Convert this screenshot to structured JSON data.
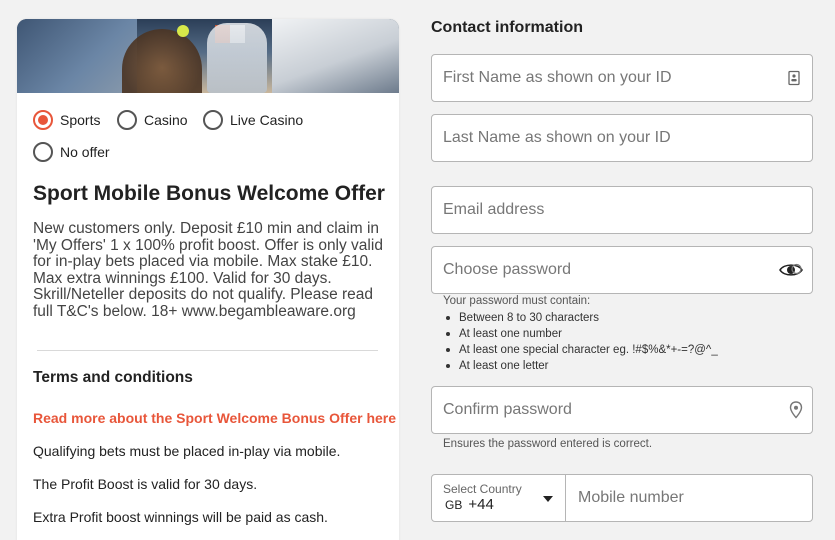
{
  "offer_card": {
    "options": [
      {
        "label": "Sports",
        "selected": true
      },
      {
        "label": "Casino",
        "selected": false
      },
      {
        "label": "Live Casino",
        "selected": false
      },
      {
        "label": "No offer",
        "selected": false
      }
    ],
    "title": "Sport Mobile Bonus Welcome Offer",
    "body": "New customers only. Deposit £10 min and claim in 'My Offers' 1 x 100% profit boost. Offer is only valid for in-play bets placed via mobile. Max stake £10. Max extra winnings £100. Valid for 30 days. Skrill/Neteller deposits do not qualify. Please read full T&C's below. 18+ www.begambleaware.org",
    "terms_title": "Terms and conditions",
    "terms_link": "Read more about the Sport Welcome Bonus Offer here",
    "terms_lines": [
      "Qualifying bets must be placed in-play via mobile.",
      "The Profit Boost is valid for 30 days.",
      "Extra Profit boost winnings will be paid as cash."
    ],
    "accent_color": "#e8563a"
  },
  "contact": {
    "title": "Contact information",
    "first_name_placeholder": "First Name as shown on your ID",
    "last_name_placeholder": "Last Name as shown on your ID",
    "email_placeholder": "Email address",
    "password_placeholder": "Choose password",
    "password_rules_title": "Your password must contain:",
    "password_rules": [
      "Between 8 to 30 characters",
      "At least one number",
      "At least one special character eg. !#$%&*+-=?@^_",
      "At least one letter"
    ],
    "confirm_placeholder": "Confirm password",
    "confirm_hint": "Ensures the password entered is correct.",
    "country_label": "Select Country",
    "country_code": "GB",
    "dial_code": "+44",
    "mobile_placeholder": "Mobile number"
  }
}
